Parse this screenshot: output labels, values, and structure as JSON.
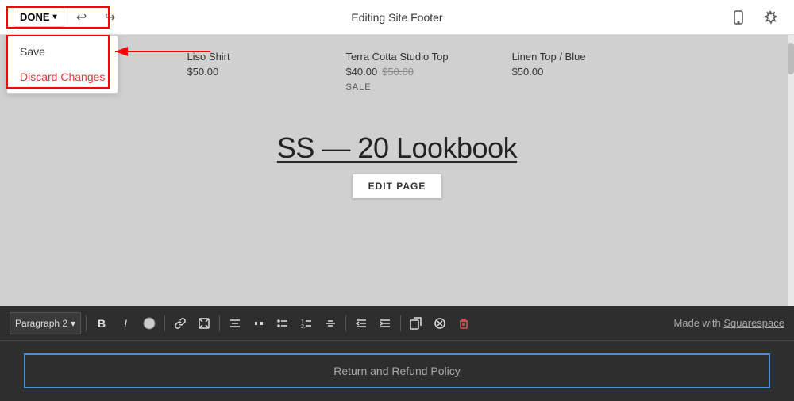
{
  "topbar": {
    "done_label": "DONE",
    "title": "Editing Site Footer",
    "undo_icon": "↩",
    "redo_icon": "↪",
    "mobile_icon": "📱",
    "settings_icon": "✦"
  },
  "dropdown": {
    "save_label": "Save",
    "discard_label": "Discard Changes"
  },
  "products": [
    {
      "name": "Liso Shirt",
      "price": "$50.00",
      "original_price": null,
      "sale": false
    },
    {
      "name": "Terra Cotta Studio Top",
      "price": "$40.00",
      "original_price": "$50.00",
      "sale": false
    },
    {
      "name": "Linen Top / Blue",
      "price": "$50.00",
      "original_price": null,
      "sale": false
    }
  ],
  "sale_badge": "SALE",
  "lookbook": {
    "title": "SS — 20 Lookbook",
    "edit_button": "EDIT PAGE"
  },
  "toolbar": {
    "paragraph_label": "Paragraph 2",
    "bold": "B",
    "italic": "I",
    "made_with": "Made with",
    "squarespace": "Squarespace"
  },
  "footer": {
    "link_text": "Return and Refund Policy"
  }
}
